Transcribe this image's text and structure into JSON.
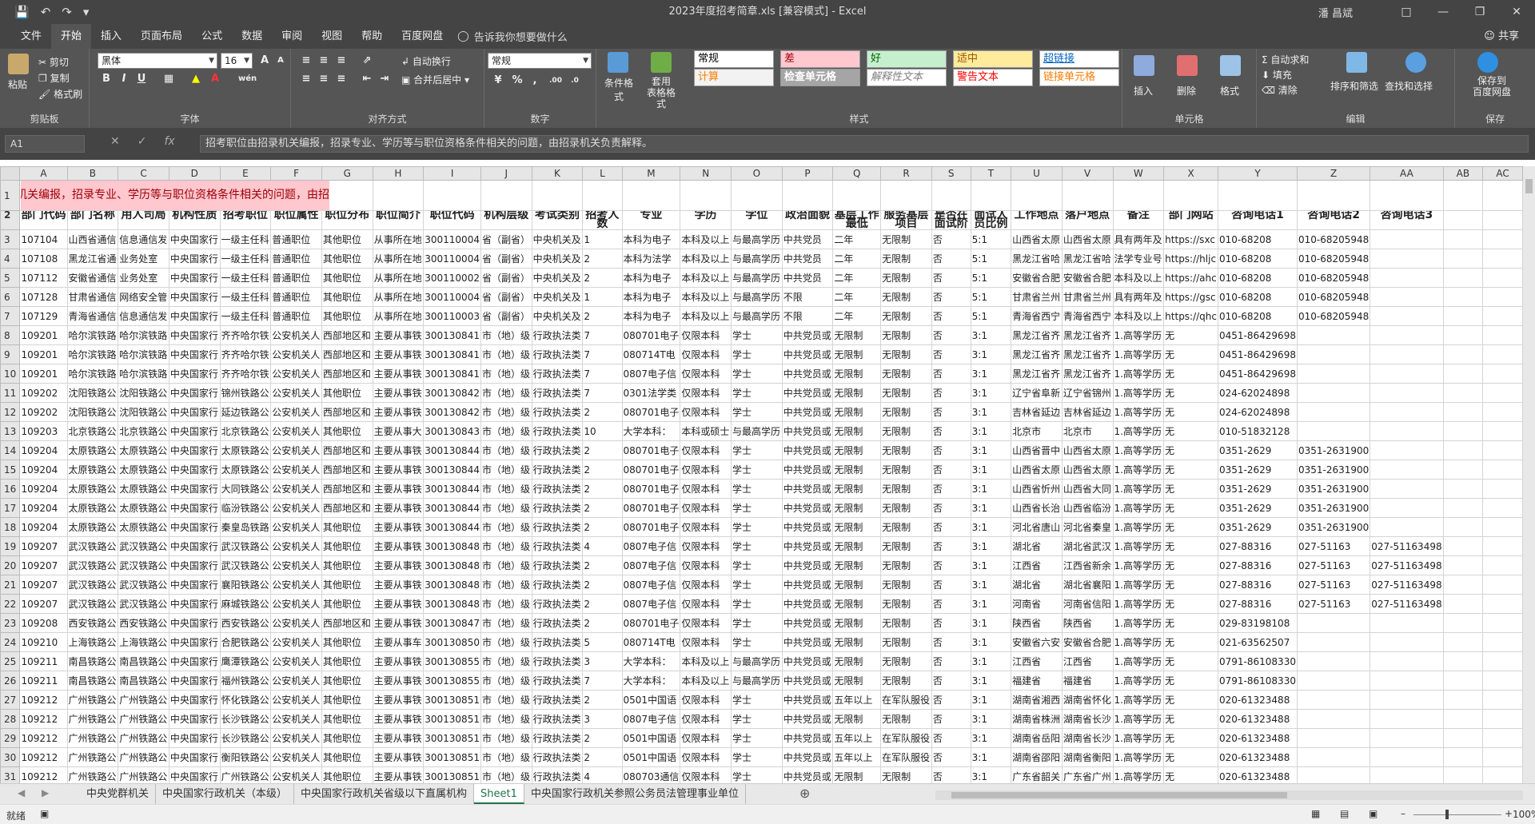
{
  "window": {
    "title": "2023年度招考简章.xls  [兼容模式]  -  Excel",
    "user": "潘 昌斌"
  },
  "menu_tabs": [
    "文件",
    "开始",
    "插入",
    "页面布局",
    "公式",
    "数据",
    "审阅",
    "视图",
    "帮助",
    "百度网盘"
  ],
  "active_tab": "开始",
  "tell_me": "告诉我你想要做什么",
  "share": "共享",
  "ribbon": {
    "clipboard": {
      "label": "剪贴板",
      "paste": "粘贴",
      "cut": "剪切",
      "copy": "复制",
      "format_painter": "格式刷"
    },
    "font": {
      "label": "字体",
      "name": "黑体",
      "size": "16",
      "bold": "B",
      "italic": "I",
      "underline": "U"
    },
    "alignment": {
      "label": "对齐方式",
      "wrap": "自动换行",
      "merge": "合并后居中"
    },
    "number": {
      "label": "数字",
      "format": "常规",
      "percent": "%",
      "comma": ","
    },
    "styles": {
      "label": "样式",
      "conditional": "条件格式",
      "table_format": "套用\n表格格式",
      "cells": [
        {
          "text": "常规",
          "bg": "#ffffff",
          "fg": "#000000"
        },
        {
          "text": "差",
          "bg": "#ffc7ce",
          "fg": "#9c0006"
        },
        {
          "text": "好",
          "bg": "#c6efce",
          "fg": "#006100"
        },
        {
          "text": "适中",
          "bg": "#ffeb9c",
          "fg": "#9c5700"
        },
        {
          "text": "超链接",
          "bg": "#ffffff",
          "fg": "#0563c1"
        },
        {
          "text": "计算",
          "bg": "#f2f2f2",
          "fg": "#fa7d00"
        },
        {
          "text": "检查单元格",
          "bg": "#a5a5a5",
          "fg": "#ffffff"
        },
        {
          "text": "解释性文本",
          "bg": "#ffffff",
          "fg": "#7f7f7f"
        },
        {
          "text": "警告文本",
          "bg": "#ffffff",
          "fg": "#ff0000"
        },
        {
          "text": "链接单元格",
          "bg": "#ffffff",
          "fg": "#fa7d00"
        }
      ]
    },
    "cells_grp": {
      "label": "单元格",
      "insert": "插入",
      "delete": "删除",
      "format": "格式"
    },
    "editing": {
      "label": "编辑",
      "autosum": "自动求和",
      "fill": "填充",
      "clear": "清除",
      "sort": "排序和筛选",
      "find": "查找和选择"
    },
    "save": {
      "label": "保存",
      "btn": "保存到\n百度网盘"
    }
  },
  "formula_bar": {
    "name_box": "A1",
    "content": "招考职位由招录机关编报，招录专业、学历等与职位资格条件相关的问题，由招录机关负责解释。"
  },
  "columns": [
    "A",
    "B",
    "C",
    "D",
    "E",
    "F",
    "G",
    "H",
    "I",
    "J",
    "K",
    "L",
    "M",
    "N",
    "O",
    "P",
    "Q",
    "R",
    "S",
    "T",
    "U",
    "V",
    "W",
    "X",
    "Y",
    "Z",
    "AA",
    "AB",
    "AC"
  ],
  "row1_text": "招考职位由招录机关编报，招录专业、学历等与职位资格条件相关的问题，由招",
  "headers": [
    "部门代码",
    "部门名称",
    "用人司局",
    "机构性质",
    "招考职位",
    "职位属性",
    "职位分布",
    "职位简介",
    "职位代码",
    "机构层级",
    "考试类别",
    "招考人数",
    "专业",
    "学历",
    "学位",
    "政治面貌",
    "基层工作最低",
    "服务基层项目",
    "是否在面试阶",
    "面试人员比例",
    "工作地点",
    "落户地点",
    "备注",
    "部门网站",
    "咨询电话1",
    "咨询电话2",
    "咨询电话3",
    "",
    ""
  ],
  "rows": [
    {
      "n": "3",
      "c": [
        "107104",
        "山西省通信",
        "信息通信发",
        "中央国家行",
        "一级主任科",
        "普通职位",
        "其他职位",
        "从事所在地",
        "300110004",
        "省（副省）",
        "中央机关及",
        "1",
        "本科为电子",
        "本科及以上",
        "与最高学历",
        "中共党员",
        "二年",
        "无限制",
        "否",
        "5:1",
        "山西省太原",
        "山西省太原",
        "具有两年及",
        "https://sxc",
        "010-68208",
        "010-68205948",
        "",
        "",
        ""
      ]
    },
    {
      "n": "4",
      "c": [
        "107108",
        "黑龙江省通",
        "业务处室",
        "中央国家行",
        "一级主任科",
        "普通职位",
        "其他职位",
        "从事所在地",
        "300110004",
        "省（副省）",
        "中央机关及",
        "2",
        "本科为法学",
        "本科及以上",
        "与最高学历",
        "中共党员",
        "二年",
        "无限制",
        "否",
        "5:1",
        "黑龙江省哈",
        "黑龙江省哈",
        "法学专业号",
        "https://hljc",
        "010-68208",
        "010-68205948",
        "",
        "",
        ""
      ]
    },
    {
      "n": "5",
      "c": [
        "107112",
        "安徽省通信",
        "业务处室",
        "中央国家行",
        "一级主任科",
        "普通职位",
        "其他职位",
        "从事所在地",
        "300110002",
        "省（副省）",
        "中央机关及",
        "2",
        "本科为电子",
        "本科及以上",
        "与最高学历",
        "中共党员",
        "二年",
        "无限制",
        "否",
        "5:1",
        "安徽省合肥",
        "安徽省合肥",
        "本科及以上",
        "https://ahc",
        "010-68208",
        "010-68205948",
        "",
        "",
        ""
      ]
    },
    {
      "n": "6",
      "c": [
        "107128",
        "甘肃省通信",
        "网络安全管",
        "中央国家行",
        "一级主任科",
        "普通职位",
        "其他职位",
        "从事所在地",
        "300110004",
        "省（副省）",
        "中央机关及",
        "1",
        "本科为电子",
        "本科及以上",
        "与最高学历",
        "不限",
        "二年",
        "无限制",
        "否",
        "5:1",
        "甘肃省兰州",
        "甘肃省兰州",
        "具有两年及",
        "https://gsc",
        "010-68208",
        "010-68205948",
        "",
        "",
        ""
      ]
    },
    {
      "n": "7",
      "c": [
        "107129",
        "青海省通信",
        "信息通信发",
        "中央国家行",
        "一级主任科",
        "普通职位",
        "其他职位",
        "从事所在地",
        "300110003",
        "省（副省）",
        "中央机关及",
        "2",
        "本科为电子",
        "本科及以上",
        "与最高学历",
        "不限",
        "二年",
        "无限制",
        "否",
        "5:1",
        "青海省西宁",
        "青海省西宁",
        "本科及以上",
        "https://qhc",
        "010-68208",
        "010-68205948",
        "",
        "",
        ""
      ]
    },
    {
      "n": "8",
      "c": [
        "109201",
        "哈尔滨铁路",
        "哈尔滨铁路",
        "中央国家行",
        "齐齐哈尔铁",
        "公安机关人",
        "西部地区和",
        "主要从事铁",
        "300130841",
        "市（地）级",
        "行政执法类",
        "7",
        "080701电子",
        "仅限本科",
        "学士",
        "中共党员或",
        "无限制",
        "无限制",
        "否",
        "3:1",
        "黑龙江省齐",
        "黑龙江省齐",
        "1.高等学历",
        "无",
        "0451-86429698",
        "",
        "",
        "",
        ""
      ]
    },
    {
      "n": "9",
      "c": [
        "109201",
        "哈尔滨铁路",
        "哈尔滨铁路",
        "中央国家行",
        "齐齐哈尔铁",
        "公安机关人",
        "西部地区和",
        "主要从事铁",
        "300130841",
        "市（地）级",
        "行政执法类",
        "7",
        "080714T电",
        "仅限本科",
        "学士",
        "中共党员或",
        "无限制",
        "无限制",
        "否",
        "3:1",
        "黑龙江省齐",
        "黑龙江省齐",
        "1.高等学历",
        "无",
        "0451-86429698",
        "",
        "",
        "",
        ""
      ]
    },
    {
      "n": "10",
      "c": [
        "109201",
        "哈尔滨铁路",
        "哈尔滨铁路",
        "中央国家行",
        "齐齐哈尔铁",
        "公安机关人",
        "西部地区和",
        "主要从事铁",
        "300130841",
        "市（地）级",
        "行政执法类",
        "7",
        "0807电子信",
        "仅限本科",
        "学士",
        "中共党员或",
        "无限制",
        "无限制",
        "否",
        "3:1",
        "黑龙江省齐",
        "黑龙江省齐",
        "1.高等学历",
        "无",
        "0451-86429698",
        "",
        "",
        "",
        ""
      ]
    },
    {
      "n": "11",
      "c": [
        "109202",
        "沈阳铁路公",
        "沈阳铁路公",
        "中央国家行",
        "锦州铁路公",
        "公安机关人",
        "其他职位",
        "主要从事铁",
        "300130842",
        "市（地）级",
        "行政执法类",
        "7",
        "0301法学类",
        "仅限本科",
        "学士",
        "中共党员或",
        "无限制",
        "无限制",
        "否",
        "3:1",
        "辽宁省阜新",
        "辽宁省锦州",
        "1.高等学历",
        "无",
        "024-62024898",
        "",
        "",
        "",
        ""
      ]
    },
    {
      "n": "12",
      "c": [
        "109202",
        "沈阳铁路公",
        "沈阳铁路公",
        "中央国家行",
        "延边铁路公",
        "公安机关人",
        "西部地区和",
        "主要从事铁",
        "300130842",
        "市（地）级",
        "行政执法类",
        "2",
        "080701电子",
        "仅限本科",
        "学士",
        "中共党员或",
        "无限制",
        "无限制",
        "否",
        "3:1",
        "吉林省延边",
        "吉林省延边",
        "1.高等学历",
        "无",
        "024-62024898",
        "",
        "",
        "",
        ""
      ]
    },
    {
      "n": "13",
      "c": [
        "109203",
        "北京铁路公",
        "北京铁路公",
        "中央国家行",
        "北京铁路公",
        "公安机关人",
        "其他职位",
        "主要从事大",
        "300130843",
        "市（地）级",
        "行政执法类",
        "10",
        "大学本科：",
        "本科或硕士",
        "与最高学历",
        "中共党员或",
        "无限制",
        "无限制",
        "否",
        "3:1",
        "北京市",
        "北京市",
        "1.高等学历",
        "无",
        "010-51832128",
        "",
        "",
        "",
        ""
      ]
    },
    {
      "n": "14",
      "c": [
        "109204",
        "太原铁路公",
        "太原铁路公",
        "中央国家行",
        "太原铁路公",
        "公安机关人",
        "西部地区和",
        "主要从事铁",
        "300130844",
        "市（地）级",
        "行政执法类",
        "2",
        "080701电子",
        "仅限本科",
        "学士",
        "中共党员或",
        "无限制",
        "无限制",
        "否",
        "3:1",
        "山西省晋中",
        "山西省太原",
        "1.高等学历",
        "无",
        "0351-2629",
        "0351-2631900",
        "",
        "",
        ""
      ]
    },
    {
      "n": "15",
      "c": [
        "109204",
        "太原铁路公",
        "太原铁路公",
        "中央国家行",
        "太原铁路公",
        "公安机关人",
        "西部地区和",
        "主要从事铁",
        "300130844",
        "市（地）级",
        "行政执法类",
        "2",
        "080701电子",
        "仅限本科",
        "学士",
        "中共党员或",
        "无限制",
        "无限制",
        "否",
        "3:1",
        "山西省太原",
        "山西省太原",
        "1.高等学历",
        "无",
        "0351-2629",
        "0351-2631900",
        "",
        "",
        ""
      ]
    },
    {
      "n": "16",
      "c": [
        "109204",
        "太原铁路公",
        "太原铁路公",
        "中央国家行",
        "大同铁路公",
        "公安机关人",
        "西部地区和",
        "主要从事铁",
        "300130844",
        "市（地）级",
        "行政执法类",
        "2",
        "080701电子",
        "仅限本科",
        "学士",
        "中共党员或",
        "无限制",
        "无限制",
        "否",
        "3:1",
        "山西省忻州",
        "山西省大同",
        "1.高等学历",
        "无",
        "0351-2629",
        "0351-2631900",
        "",
        "",
        ""
      ]
    },
    {
      "n": "17",
      "c": [
        "109204",
        "太原铁路公",
        "太原铁路公",
        "中央国家行",
        "临汾铁路公",
        "公安机关人",
        "西部地区和",
        "主要从事铁",
        "300130844",
        "市（地）级",
        "行政执法类",
        "2",
        "080701电子",
        "仅限本科",
        "学士",
        "中共党员或",
        "无限制",
        "无限制",
        "否",
        "3:1",
        "山西省长治",
        "山西省临汾",
        "1.高等学历",
        "无",
        "0351-2629",
        "0351-2631900",
        "",
        "",
        ""
      ]
    },
    {
      "n": "18",
      "c": [
        "109204",
        "太原铁路公",
        "太原铁路公",
        "中央国家行",
        "秦皇岛铁路",
        "公安机关人",
        "其他职位",
        "主要从事铁",
        "300130844",
        "市（地）级",
        "行政执法类",
        "2",
        "080701电子",
        "仅限本科",
        "学士",
        "中共党员或",
        "无限制",
        "无限制",
        "否",
        "3:1",
        "河北省唐山",
        "河北省秦皇",
        "1.高等学历",
        "无",
        "0351-2629",
        "0351-2631900",
        "",
        "",
        ""
      ]
    },
    {
      "n": "19",
      "c": [
        "109207",
        "武汉铁路公",
        "武汉铁路公",
        "中央国家行",
        "武汉铁路公",
        "公安机关人",
        "其他职位",
        "主要从事铁",
        "300130848",
        "市（地）级",
        "行政执法类",
        "4",
        "0807电子信",
        "仅限本科",
        "学士",
        "中共党员或",
        "无限制",
        "无限制",
        "否",
        "3:1",
        "湖北省",
        "湖北省武汉",
        "1.高等学历",
        "无",
        "027-88316",
        "027-51163",
        "027-51163498",
        "",
        ""
      ]
    },
    {
      "n": "20",
      "c": [
        "109207",
        "武汉铁路公",
        "武汉铁路公",
        "中央国家行",
        "武汉铁路公",
        "公安机关人",
        "其他职位",
        "主要从事铁",
        "300130848",
        "市（地）级",
        "行政执法类",
        "2",
        "0807电子信",
        "仅限本科",
        "学士",
        "中共党员或",
        "无限制",
        "无限制",
        "否",
        "3:1",
        "江西省",
        "江西省新余",
        "1.高等学历",
        "无",
        "027-88316",
        "027-51163",
        "027-51163498",
        "",
        ""
      ]
    },
    {
      "n": "21",
      "c": [
        "109207",
        "武汉铁路公",
        "武汉铁路公",
        "中央国家行",
        "襄阳铁路公",
        "公安机关人",
        "其他职位",
        "主要从事铁",
        "300130848",
        "市（地）级",
        "行政执法类",
        "2",
        "0807电子信",
        "仅限本科",
        "学士",
        "中共党员或",
        "无限制",
        "无限制",
        "否",
        "3:1",
        "湖北省",
        "湖北省襄阳",
        "1.高等学历",
        "无",
        "027-88316",
        "027-51163",
        "027-51163498",
        "",
        ""
      ]
    },
    {
      "n": "22",
      "c": [
        "109207",
        "武汉铁路公",
        "武汉铁路公",
        "中央国家行",
        "麻城铁路公",
        "公安机关人",
        "其他职位",
        "主要从事铁",
        "300130848",
        "市（地）级",
        "行政执法类",
        "2",
        "0807电子信",
        "仅限本科",
        "学士",
        "中共党员或",
        "无限制",
        "无限制",
        "否",
        "3:1",
        "河南省",
        "河南省信阳",
        "1.高等学历",
        "无",
        "027-88316",
        "027-51163",
        "027-51163498",
        "",
        ""
      ]
    },
    {
      "n": "23",
      "c": [
        "109208",
        "西安铁路公",
        "西安铁路公",
        "中央国家行",
        "西安铁路公",
        "公安机关人",
        "西部地区和",
        "主要从事铁",
        "300130847",
        "市（地）级",
        "行政执法类",
        "2",
        "080701电子",
        "仅限本科",
        "学士",
        "中共党员或",
        "无限制",
        "无限制",
        "否",
        "3:1",
        "陕西省",
        "陕西省",
        "1.高等学历",
        "无",
        "029-83198108",
        "",
        "",
        "",
        ""
      ]
    },
    {
      "n": "24",
      "c": [
        "109210",
        "上海铁路公",
        "上海铁路公",
        "中央国家行",
        "合肥铁路公",
        "公安机关人",
        "其他职位",
        "主要从事车",
        "300130850",
        "市（地）级",
        "行政执法类",
        "5",
        "080714T电",
        "仅限本科",
        "学士",
        "中共党员或",
        "无限制",
        "无限制",
        "否",
        "3:1",
        "安徽省六安",
        "安徽省合肥",
        "1.高等学历",
        "无",
        "021-63562507",
        "",
        "",
        "",
        ""
      ]
    },
    {
      "n": "25",
      "c": [
        "109211",
        "南昌铁路公",
        "南昌铁路公",
        "中央国家行",
        "鹰潭铁路公",
        "公安机关人",
        "其他职位",
        "主要从事铁",
        "300130855",
        "市（地）级",
        "行政执法类",
        "3",
        "大学本科：",
        "本科及以上",
        "与最高学历",
        "中共党员或",
        "无限制",
        "无限制",
        "否",
        "3:1",
        "江西省",
        "江西省",
        "1.高等学历",
        "无",
        "0791-86108330",
        "",
        "",
        "",
        ""
      ]
    },
    {
      "n": "26",
      "c": [
        "109211",
        "南昌铁路公",
        "南昌铁路公",
        "中央国家行",
        "福州铁路公",
        "公安机关人",
        "其他职位",
        "主要从事铁",
        "300130855",
        "市（地）级",
        "行政执法类",
        "7",
        "大学本科：",
        "本科及以上",
        "与最高学历",
        "中共党员或",
        "无限制",
        "无限制",
        "否",
        "3:1",
        "福建省",
        "福建省",
        "1.高等学历",
        "无",
        "0791-86108330",
        "",
        "",
        "",
        ""
      ]
    },
    {
      "n": "27",
      "c": [
        "109212",
        "广州铁路公",
        "广州铁路公",
        "中央国家行",
        "怀化铁路公",
        "公安机关人",
        "其他职位",
        "主要从事铁",
        "300130851",
        "市（地）级",
        "行政执法类",
        "2",
        "0501中国语",
        "仅限本科",
        "学士",
        "中共党员或",
        "五年以上",
        "在军队服役",
        "否",
        "3:1",
        "湖南省湘西",
        "湖南省怀化",
        "1.高等学历",
        "无",
        "020-61323488",
        "",
        "",
        "",
        ""
      ]
    },
    {
      "n": "28",
      "c": [
        "109212",
        "广州铁路公",
        "广州铁路公",
        "中央国家行",
        "长沙铁路公",
        "公安机关人",
        "其他职位",
        "主要从事铁",
        "300130851",
        "市（地）级",
        "行政执法类",
        "3",
        "0807电子信",
        "仅限本科",
        "学士",
        "中共党员或",
        "无限制",
        "无限制",
        "否",
        "3:1",
        "湖南省株洲",
        "湖南省长沙",
        "1.高等学历",
        "无",
        "020-61323488",
        "",
        "",
        "",
        ""
      ]
    },
    {
      "n": "29",
      "c": [
        "109212",
        "广州铁路公",
        "广州铁路公",
        "中央国家行",
        "长沙铁路公",
        "公安机关人",
        "其他职位",
        "主要从事铁",
        "300130851",
        "市（地）级",
        "行政执法类",
        "2",
        "0501中国语",
        "仅限本科",
        "学士",
        "中共党员或",
        "五年以上",
        "在军队服役",
        "否",
        "3:1",
        "湖南省岳阳",
        "湖南省长沙",
        "1.高等学历",
        "无",
        "020-61323488",
        "",
        "",
        "",
        ""
      ]
    },
    {
      "n": "30",
      "c": [
        "109212",
        "广州铁路公",
        "广州铁路公",
        "中央国家行",
        "衡阳铁路公",
        "公安机关人",
        "其他职位",
        "主要从事铁",
        "300130851",
        "市（地）级",
        "行政执法类",
        "2",
        "0501中国语",
        "仅限本科",
        "学士",
        "中共党员或",
        "五年以上",
        "在军队服役",
        "否",
        "3:1",
        "湖南省邵阳",
        "湖南省衡阳",
        "1.高等学历",
        "无",
        "020-61323488",
        "",
        "",
        "",
        ""
      ]
    },
    {
      "n": "31",
      "c": [
        "109212",
        "广州铁路公",
        "广州铁路公",
        "中央国家行",
        "广州铁路公",
        "公安机关人",
        "其他职位",
        "主要从事铁",
        "300130851",
        "市（地）级",
        "行政执法类",
        "4",
        "080703通信",
        "仅限本科",
        "学士",
        "中共党员或",
        "无限制",
        "无限制",
        "否",
        "3:1",
        "广东省韶关",
        "广东省广州",
        "1.高等学历",
        "无",
        "020-61323488",
        "",
        "",
        "",
        ""
      ]
    }
  ],
  "sheets": [
    "中央党群机关",
    "中央国家行政机关（本级）",
    "中央国家行政机关省级以下直属机构",
    "Sheet1",
    "中央国家行政机关参照公务员法管理事业单位"
  ],
  "active_sheet": "Sheet1",
  "status": {
    "ready": "就绪",
    "zoom": "100%"
  }
}
